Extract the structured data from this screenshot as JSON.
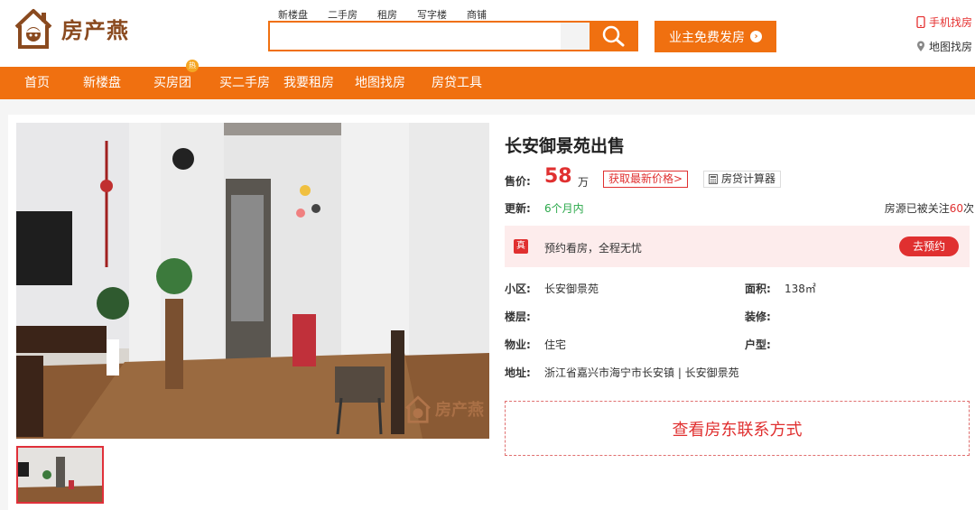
{
  "header": {
    "logo_text": "房产燕",
    "search_tabs": [
      "新楼盘",
      "二手房",
      "租房",
      "写字楼",
      "商铺"
    ],
    "search_value": "",
    "post_button": "业主免费发房",
    "mobile_link": "手机找房",
    "map_link": "地图找房"
  },
  "nav": {
    "items": [
      "首页",
      "新楼盘",
      "买房团",
      "买二手房",
      "我要租房",
      "地图找房",
      "房贷工具"
    ],
    "hot_badge": "热"
  },
  "listing": {
    "title": "长安御景苑出售",
    "price_label": "售价:",
    "price_value": "58",
    "price_unit": "万",
    "get_price": "获取最新价格>",
    "calculator": "房贷计算器",
    "update_label": "更新:",
    "update_value": "6个月内",
    "follow_prefix": "房源已被关注",
    "follow_count": "60",
    "follow_suffix": "次",
    "banner_badge": "真",
    "banner_text": "预约看房，全程无忧",
    "book_button": "去预约",
    "community_label": "小区:",
    "community_value": "长安御景苑",
    "area_label": "面积:",
    "area_value": "138㎡",
    "floor_label": "楼层:",
    "floor_value": "",
    "decor_label": "装修:",
    "decor_value": "",
    "property_label": "物业:",
    "property_value": "住宅",
    "layout_label": "户型:",
    "layout_value": "",
    "address_label": "地址:",
    "address_value": "浙江省嘉兴市海宁市长安镇 | 长安御景苑",
    "contact_button": "查看房东联系方式",
    "watermark": "房产燕"
  },
  "colors": {
    "brand_orange": "#f07010",
    "accent_red": "#e03030",
    "update_green": "#2aa84a",
    "logo_brown": "#8a4a1f"
  }
}
